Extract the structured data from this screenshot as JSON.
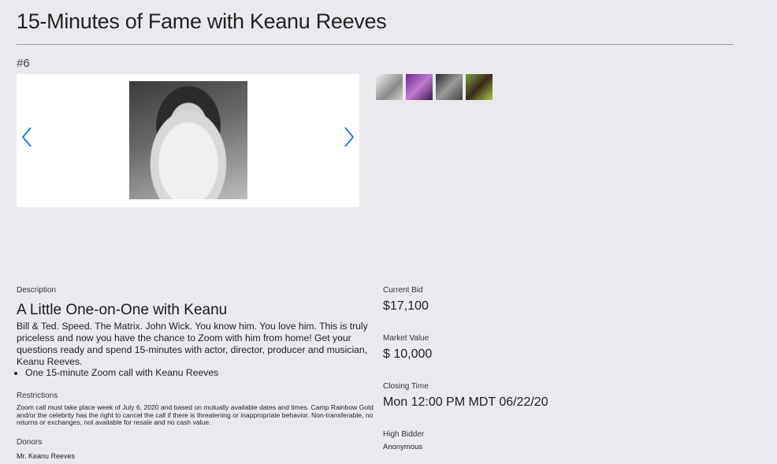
{
  "page": {
    "title": "15-Minutes of Fame with Keanu Reeves",
    "lot_number": "#6"
  },
  "description": {
    "label": "Description",
    "heading": "A Little One-on-One with Keanu",
    "text": "Bill & Ted. Speed. The Matrix. John Wick. You know him. You love him. This is truly priceless and now you have the chance to Zoom with him from home! Get your questions ready and spend 15-minutes with actor, director, producer and musician, Keanu Reeves.",
    "bullets": [
      "One 15-minute Zoom call with Keanu Reeves"
    ]
  },
  "restrictions": {
    "label": "Restrictions",
    "text": "Zoom call must take place week of July 6, 2020 and based on mutually available dates and times. Camp Rainbow Gold and/or the celebrity has the right to cancel the call if there is threatening or inappropriate behavior. Non-transferable, no returns or exchanges, not available for resale and no cash value."
  },
  "donors": {
    "label": "Donors",
    "name": "Mr. Keanu Reeves"
  },
  "bid": {
    "current_bid_label": "Current Bid",
    "current_bid": "$17,100",
    "market_value_label": "Market Value",
    "market_value": "$ 10,000",
    "closing_time_label": "Closing Time",
    "closing_time": "Mon 12:00 PM MDT 06/22/20",
    "high_bidder_label": "High Bidder",
    "high_bidder": "Anonymous"
  },
  "icons": {
    "prev": "chevron-left-icon",
    "next": "chevron-right-icon"
  },
  "colors": {
    "background": "#ebe9ee",
    "arrow": "#1a73e8"
  }
}
